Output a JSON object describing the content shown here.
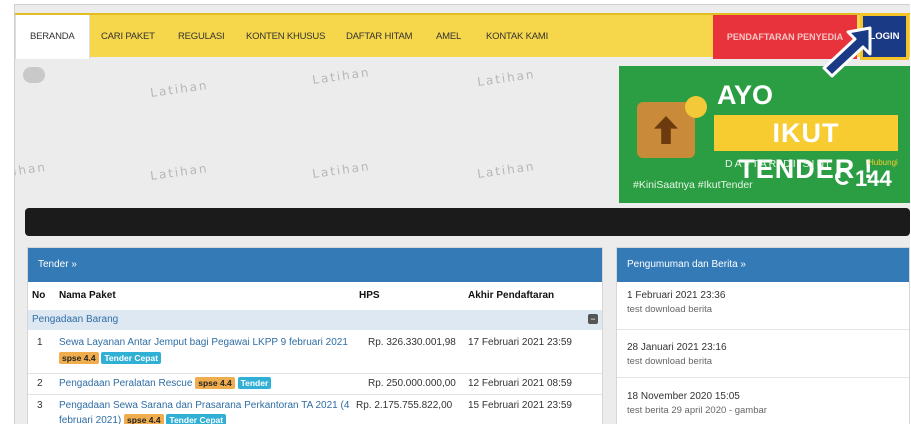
{
  "nav": {
    "items": [
      {
        "label": "BERANDA",
        "active": true
      },
      {
        "label": "CARI PAKET"
      },
      {
        "label": "REGULASI"
      },
      {
        "label": "KONTEN KHUSUS"
      },
      {
        "label": "DAFTAR HITAM"
      },
      {
        "label": "AMEL"
      },
      {
        "label": "KONTAK KAMI"
      }
    ],
    "register_label": "PENDAFTARAN PENYEDIA",
    "login_label": "LOGIN"
  },
  "watermark": {
    "text": "Latihan",
    "partial": "ihan"
  },
  "banner": {
    "ayo": "AYO",
    "ikut": "IKUT TENDER !",
    "daftar": "DAFTAR DI SINI",
    "tags": "#KiniSaatnya #IkutTender",
    "hubungi": "Hubungi",
    "number": "144"
  },
  "tender": {
    "title": "Tender »",
    "headers": {
      "no": "No",
      "name": "Nama Paket",
      "hps": "HPS",
      "deadline": "Akhir Pendaftaran"
    },
    "group": "Pengadaan Barang",
    "rows": [
      {
        "no": "1",
        "name": "Sewa Layanan Antar Jemput bagi Pegawai LKPP 9 februari 2021",
        "badge_version": "spse 4.4",
        "badge_type": "Tender Cepat",
        "hps": "Rp. 326.330.001,98",
        "deadline": "17 Februari 2021 23:59"
      },
      {
        "no": "2",
        "name": "Pengadaan Peralatan Rescue",
        "badge_version": "spse 4.4",
        "badge_type": "Tender",
        "hps": "Rp. 250.000.000,00",
        "deadline": "12 Februari 2021 08:59"
      },
      {
        "no": "3",
        "name_line1": "Pengadaan Sewa Sarana dan Prasarana Perkantoran TA 2021 (4",
        "name_line2": "februari 2021)",
        "badge_version": "spse 4.4",
        "badge_type": "Tender Cepat",
        "hps": "Rp. 2.175.755.822,00",
        "deadline": "15 Februari 2021 23:59"
      }
    ]
  },
  "news": {
    "title": "Pengumuman dan Berita »",
    "items": [
      {
        "date": "1 Februari 2021 23:36",
        "title": "test download berita"
      },
      {
        "date": "28 Januari 2021 23:16",
        "title": "test download berita"
      },
      {
        "date": "18 November 2020 15:05",
        "title": "test berita 29 april 2020 - gambar"
      }
    ]
  },
  "colors": {
    "nav": "#f6d64a",
    "login": "#1b3a86",
    "register": "#e8333c",
    "panel_head": "#337ab7",
    "banner": "#2b9e43"
  }
}
